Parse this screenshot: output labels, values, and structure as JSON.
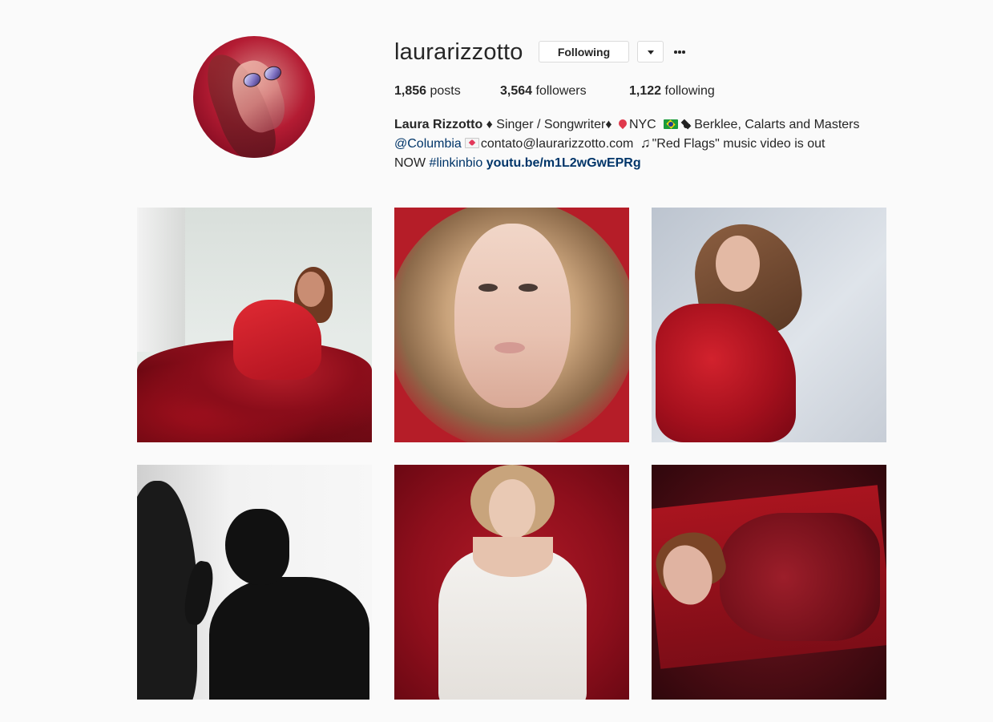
{
  "profile": {
    "username": "laurarizzotto",
    "follow_button_label": "Following",
    "stats": {
      "posts_count": "1,856",
      "posts_label": "posts",
      "followers_count": "3,564",
      "followers_label": "followers",
      "following_count": "1,122",
      "following_label": "following"
    },
    "bio": {
      "full_name": "Laura Rizzotto",
      "line1_part1": " ♦ Singer / Songwriter♦ ",
      "line1_part2": "NYC ",
      "line1_part3": "Berklee, Calarts and Masters",
      "mention": "@Columbia",
      "email": "contato@laurarizzotto.com ",
      "line2_part2": "\"Red Flags\" music video is out",
      "line3_part1": "NOW ",
      "hashtag": "#linkinbio",
      "link": "youtu.be/m1L2wGwEPRg"
    },
    "icons": {
      "avatar": "avatar",
      "dropdown": "chevron-down-icon",
      "more": "more-options-icon",
      "pin": "pin-icon",
      "flag": "brazil-flag-icon",
      "cap": "graduation-cap-icon",
      "mail": "mail-icon",
      "note": "music-note-icon"
    },
    "colors": {
      "link": "#003569",
      "border": "#dbdbdb",
      "background": "#fafafa"
    }
  },
  "posts": [
    {
      "subject": "woman in red dress on rose petals"
    },
    {
      "subject": "close-up face on red petals"
    },
    {
      "subject": "woman wrapped in red blanket"
    },
    {
      "subject": "silhouettes of a couple"
    },
    {
      "subject": "woman in white dress on rose petals"
    },
    {
      "subject": "woman in red sequin dress lying down"
    }
  ]
}
